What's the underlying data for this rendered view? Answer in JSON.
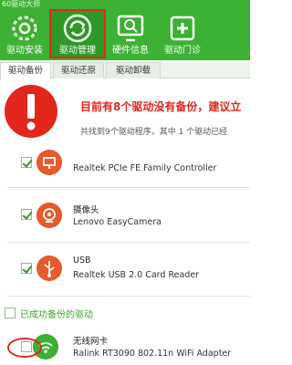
{
  "app": {
    "title": "60驱动大师"
  },
  "toolbar": {
    "items": [
      {
        "label": "驱动安装",
        "icon": "gear-icon"
      },
      {
        "label": "驱动管理",
        "icon": "refresh-icon"
      },
      {
        "label": "硬件信息",
        "icon": "monitor-search-icon"
      },
      {
        "label": "驱动门诊",
        "icon": "clinic-plus-icon"
      }
    ],
    "active_index": 1
  },
  "subtabs": {
    "items": [
      "驱动备份",
      "驱动还原",
      "驱动卸载"
    ],
    "active_index": 0
  },
  "banner": {
    "title": "目前有8个驱动没有备份，建议立",
    "subtitle": "共找到9个驱动程序，其中 1 个驱动已经"
  },
  "drivers_unbacked": [
    {
      "name": "",
      "desc": "Realtek PCIe FE Family Controller",
      "checked": true,
      "icon": "network-icon"
    },
    {
      "name": "摄像头",
      "desc": "Lenovo EasyCamera",
      "checked": true,
      "icon": "camera-icon"
    },
    {
      "name": "USB",
      "desc": "Realtek USB 2.0 Card Reader",
      "checked": true,
      "icon": "usb-icon"
    }
  ],
  "backed_section": {
    "label": "已成功备份的驱动",
    "checked": false
  },
  "drivers_backed": [
    {
      "name": "无线网卡",
      "desc": "Ralink RT3090 802.11n WiFi Adapter",
      "checked": false,
      "icon": "wifi-icon"
    }
  ],
  "colors": {
    "brand_green": "#3cb133",
    "accent_red": "#e2261c",
    "device_orange": "#e75a2c"
  }
}
